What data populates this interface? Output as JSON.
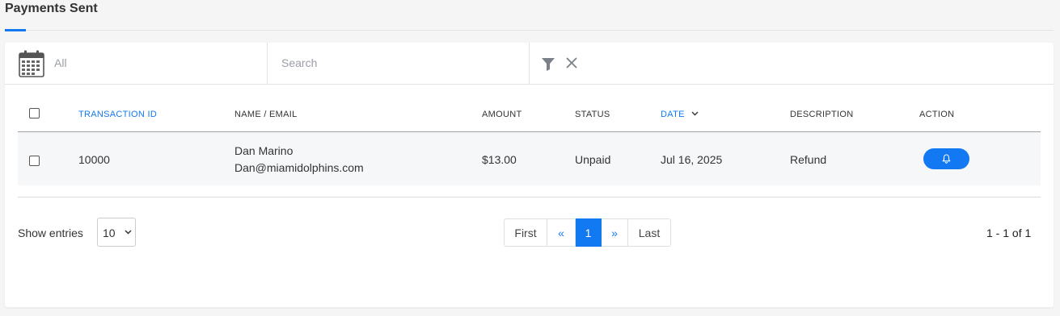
{
  "page": {
    "title": "Payments Sent"
  },
  "filters": {
    "date_value": "All",
    "search_placeholder": "Search"
  },
  "table": {
    "columns": {
      "transaction_id": "TRANSACTION ID",
      "name_email": "NAME / EMAIL",
      "amount": "AMOUNT",
      "status": "STATUS",
      "date": "DATE",
      "description": "DESCRIPTION",
      "action": "ACTION"
    },
    "rows": [
      {
        "transaction_id": "10000",
        "name": "Dan Marino",
        "email": "Dan@miamidolphins.com",
        "amount": "$13.00",
        "status": "Unpaid",
        "date": "Jul 16, 2025",
        "description": "Refund",
        "action_icon": "bell-icon"
      }
    ]
  },
  "footer": {
    "show_entries_label": "Show entries",
    "entries_value": "10",
    "pagination": {
      "first": "First",
      "prev": "«",
      "current": "1",
      "next": "»",
      "last": "Last"
    },
    "range_text": "1 - 1 of 1"
  },
  "colors": {
    "accent": "#1279f2",
    "row_background": "#f6f7f9",
    "page_background": "#f5f5f6"
  }
}
